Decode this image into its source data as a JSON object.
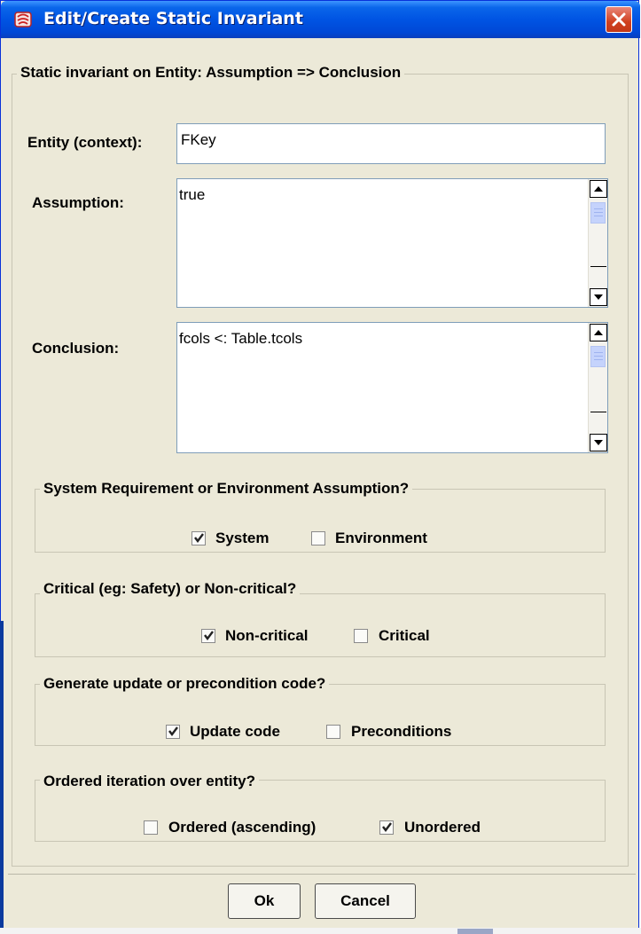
{
  "window": {
    "title": "Edit/Create Static Invariant",
    "title_icon": "app-icon",
    "close_icon": "close-icon"
  },
  "main_group": {
    "legend": "Static invariant on Entity: Assumption => Conclusion"
  },
  "entity": {
    "label": "Entity (context):",
    "value": "FKey"
  },
  "assumption": {
    "label": "Assumption:",
    "value": "true"
  },
  "conclusion": {
    "label": "Conclusion:",
    "value": "fcols <: Table.tcols"
  },
  "groups": [
    {
      "legend": "System Requirement or Environment Assumption?",
      "options": [
        {
          "label": "System",
          "checked": true
        },
        {
          "label": "Environment",
          "checked": false
        }
      ]
    },
    {
      "legend": "Critical (eg: Safety) or Non-critical?",
      "options": [
        {
          "label": "Non-critical",
          "checked": true
        },
        {
          "label": "Critical",
          "checked": false
        }
      ]
    },
    {
      "legend": "Generate update or precondition code?",
      "options": [
        {
          "label": "Update code",
          "checked": true
        },
        {
          "label": "Preconditions",
          "checked": false
        }
      ]
    },
    {
      "legend": "Ordered iteration over entity?",
      "options": [
        {
          "label": "Ordered (ascending)",
          "checked": false
        },
        {
          "label": "Unordered",
          "checked": true
        }
      ]
    }
  ],
  "buttons": {
    "ok": "Ok",
    "cancel": "Cancel"
  },
  "colors": {
    "titlebar": "#0054e3",
    "background": "#ece9d8",
    "close": "#d0401f",
    "check": "#222222"
  }
}
